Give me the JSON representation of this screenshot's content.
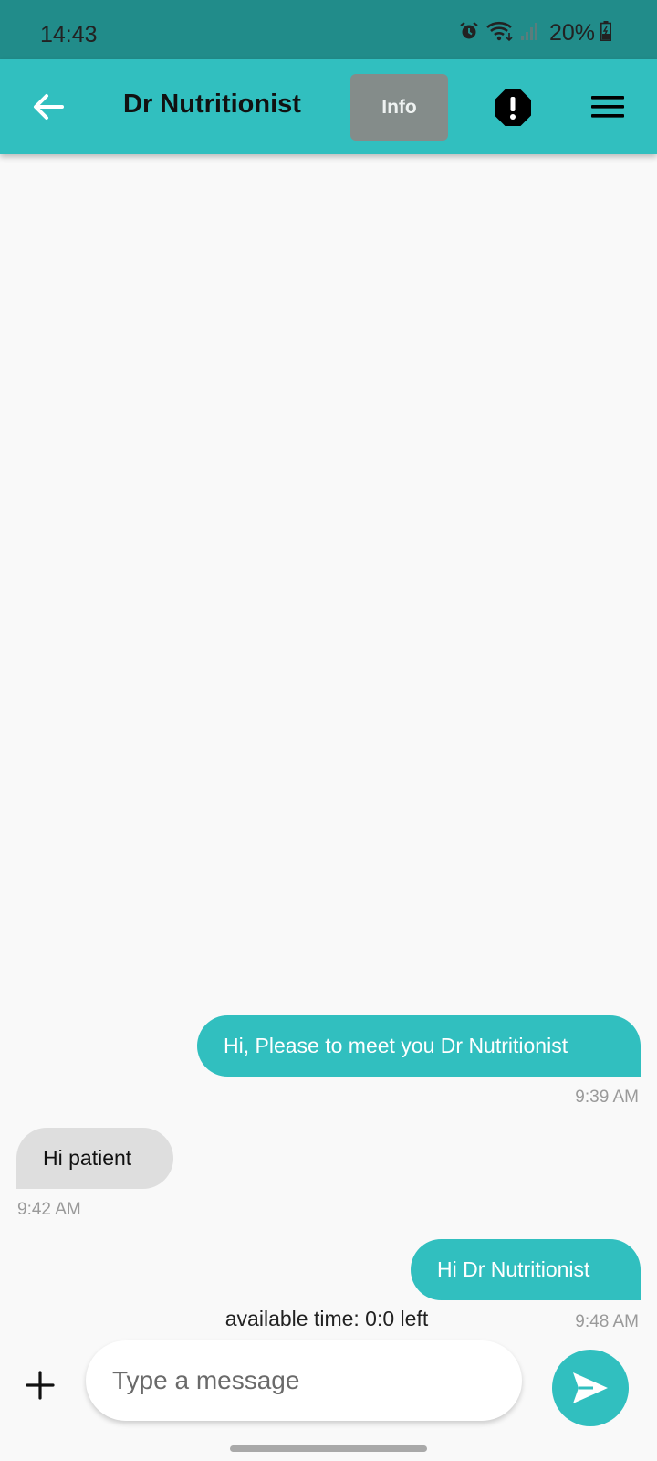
{
  "status_bar": {
    "time": "14:43",
    "battery": "20%"
  },
  "header": {
    "title": "Dr Nutritionist",
    "info_label": "Info",
    "icons": [
      "back-arrow-icon",
      "alert-octagon-icon",
      "hamburger-menu-icon"
    ]
  },
  "messages": [
    {
      "direction": "outgoing",
      "text": "Hi, Please to meet you Dr Nutritionist",
      "time": "9:39 AM"
    },
    {
      "direction": "incoming",
      "text": "Hi patient",
      "time": "9:42 AM"
    },
    {
      "direction": "outgoing",
      "text": "Hi Dr Nutritionist",
      "time": "9:48 AM"
    }
  ],
  "available_time": "available time: 0:0 left",
  "composer": {
    "placeholder": "Type a message"
  },
  "colors": {
    "accent": "#31bfbf",
    "status_bar": "#218c8a",
    "info_button": "#848c8a",
    "incoming_bubble": "#dedede"
  }
}
